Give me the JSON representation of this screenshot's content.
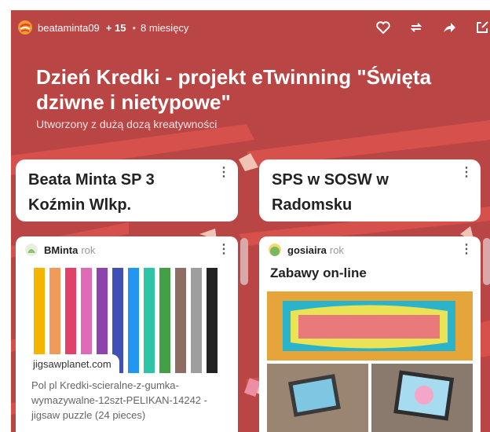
{
  "header": {
    "author": "beataminta09",
    "contributors": "+ 15",
    "separator": "•",
    "time_ago": "8 miesięcy",
    "actions": [
      "heart-icon",
      "remake-icon",
      "share-icon",
      "open-icon"
    ]
  },
  "board": {
    "title": "Dzień Kredki - projekt eTwinning \"Święta dziwne i nietypowe\"",
    "subtitle": "Utworzony z dużą dozą kreatywności",
    "background": "#b94645"
  },
  "columns": [
    {
      "name_line1": "Beata Minta SP 3",
      "name_line2": "Koźmin Wlkp.",
      "menu": "⋮"
    },
    {
      "name_line1": "SPS w SOSW w",
      "name_line2": "Radomsku",
      "menu": "⋮"
    }
  ],
  "posts": [
    {
      "author": "BMinta",
      "time": "rok",
      "menu": "⋮",
      "link_domain": "jigsawplanet.com",
      "description": "Pol pl Kredki-scieralne-z-gumka-wymazywalne-12szt-PELIKAN-14242 - jigsaw puzzle (24 pieces)",
      "pencil_colors": [
        "#f4b400",
        "#f09b5a",
        "#e2416a",
        "#e06ab8",
        "#8e44ad",
        "#3f51b5",
        "#2196f3",
        "#2ec4a6",
        "#43a047",
        "#8d6e63",
        "#9e9e9e",
        "#222222"
      ]
    },
    {
      "author": "gosiaira",
      "time": "rok",
      "menu": "⋮",
      "title": "Zabawy on-line"
    }
  ]
}
